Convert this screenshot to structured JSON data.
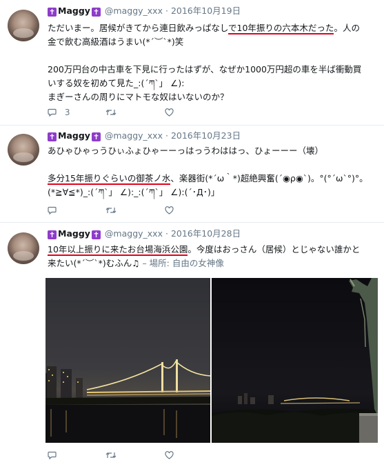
{
  "tweets": [
    {
      "name": "Maggy",
      "handle": "@maggy_xxx",
      "date": "2016年10月19日",
      "lines": [
        [
          {
            "t": "ただいまー。居候がきてから連日飲みっぱなし"
          },
          {
            "t": "で10年振りの六本木だった",
            "u": true
          },
          {
            "t": "。人の"
          }
        ],
        [
          {
            "t": "金で飲む高級酒はうまい(*´︶`*)笑"
          }
        ],
        [
          {
            "t": ""
          }
        ],
        [
          {
            "t": "200万円台の中古車を下見に行ったはずが、なぜか1000万円超の車を半ば衝動買"
          }
        ],
        [
          {
            "t": "いする奴を初めて見た_:(´ཀ`」 ∠):"
          }
        ],
        [
          {
            "t": "まぎーさんの周りにマトモな奴はいないのか？"
          }
        ]
      ],
      "reply_count": "3",
      "retweet_count": "",
      "like_count": ""
    },
    {
      "name": "Maggy",
      "handle": "@maggy_xxx",
      "date": "2016年10月23日",
      "lines": [
        [
          {
            "t": "あひゃひゃっうひぃふょひゃーーっはっうわははっ、ひょーーー（壊）"
          }
        ],
        [
          {
            "t": ""
          }
        ],
        [
          {
            "t": "多分15年振りぐらいの御茶ノ水",
            "u": true
          },
          {
            "t": "、楽器街(*´ω｀*)超絶興奮(´◉ρ◉`)。°(°´ω`°)°。"
          }
        ],
        [
          {
            "t": "(*≧∀≦*)_:(´ཀ`」 ∠):_:(´ཀ`」 ∠):(´･Д･)」"
          }
        ]
      ],
      "reply_count": "",
      "retweet_count": "",
      "like_count": ""
    },
    {
      "name": "Maggy",
      "handle": "@maggy_xxx",
      "date": "2016年10月28日",
      "lines": [
        [
          {
            "t": "10年以上振りに来たお台場海浜公園",
            "u": true
          },
          {
            "t": "。今度はおっさん（居候）とじゃない誰かと"
          }
        ],
        [
          {
            "t": "来たい(*´︶`*)むふん♫"
          },
          {
            "t": " – 場所: 自由の女神像",
            "loc": true
          }
        ]
      ],
      "reply_count": "",
      "retweet_count": "",
      "like_count": ""
    }
  ],
  "separator": "·",
  "icons": {
    "badge": "latin-cross-icon",
    "reply": "reply-icon",
    "retweet": "retweet-icon",
    "like": "heart-icon"
  },
  "colors": {
    "text": "#14171a",
    "muted": "#657786",
    "underline": "#e0001a",
    "badge": "#8e3cc9",
    "divider": "#e6ecf0"
  },
  "photos": [
    {
      "alt": "rainbow-bridge-night"
    },
    {
      "alt": "statue-of-liberty-night"
    }
  ]
}
